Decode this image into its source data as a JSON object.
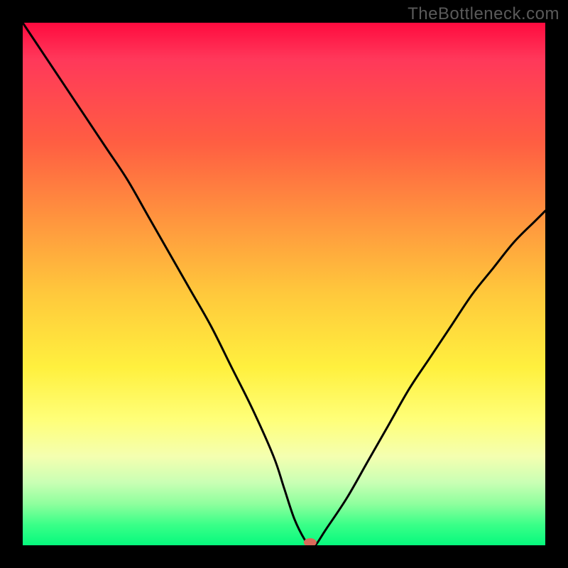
{
  "watermark_text": "TheBottleneck.com",
  "chart_data": {
    "type": "line",
    "title": "",
    "xlabel": "",
    "ylabel": "",
    "xlim": [
      0,
      100
    ],
    "ylim": [
      0,
      100
    ],
    "grid": false,
    "series": [
      {
        "name": "bottleneck-curve",
        "x": [
          0,
          4,
          8,
          12,
          16,
          20,
          24,
          28,
          32,
          36,
          40,
          44,
          48,
          50,
          52,
          54,
          55,
          56,
          58,
          62,
          66,
          70,
          74,
          78,
          82,
          86,
          90,
          94,
          98,
          100
        ],
        "y": [
          100,
          94,
          88,
          82,
          76,
          70,
          63,
          56,
          49,
          42,
          34,
          26,
          17,
          11,
          5,
          1,
          0,
          0,
          3,
          9,
          16,
          23,
          30,
          36,
          42,
          48,
          53,
          58,
          62,
          64
        ]
      }
    ],
    "marker": {
      "x": 55,
      "y": 0,
      "name": "minimum-point"
    },
    "background_gradient": {
      "axis": "y",
      "stops": [
        {
          "y": 100,
          "color": "#ff0b3f"
        },
        {
          "y": 60,
          "color": "#ff963e"
        },
        {
          "y": 30,
          "color": "#fff03e"
        },
        {
          "y": 12,
          "color": "#c9ffb4"
        },
        {
          "y": 0,
          "color": "#06f97d"
        }
      ]
    }
  }
}
